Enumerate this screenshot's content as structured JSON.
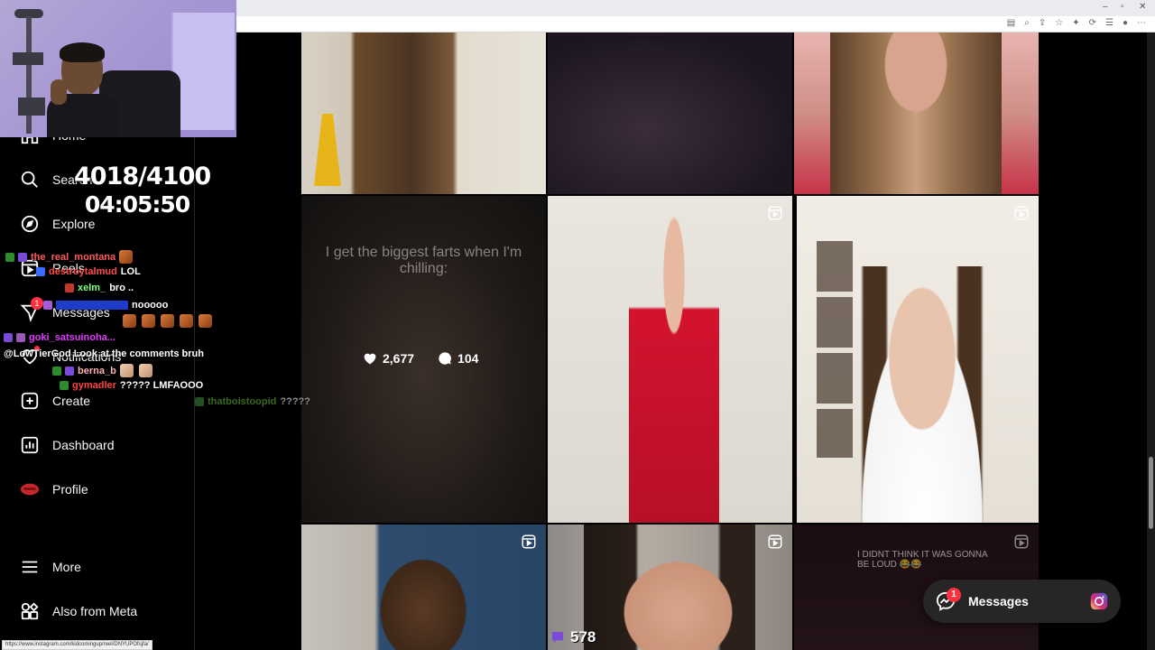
{
  "sidebar": {
    "items": [
      {
        "label": "Home",
        "icon": "home-icon"
      },
      {
        "label": "Search",
        "icon": "search-icon"
      },
      {
        "label": "Explore",
        "icon": "compass-icon"
      },
      {
        "label": "Reels",
        "icon": "reels-icon"
      },
      {
        "label": "Messages",
        "icon": "messenger-icon",
        "badge": "1"
      },
      {
        "label": "Notifications",
        "icon": "heart-icon"
      },
      {
        "label": "Create",
        "icon": "plus-square-icon"
      },
      {
        "label": "Dashboard",
        "icon": "dashboard-icon"
      },
      {
        "label": "Profile",
        "icon": "avatar"
      },
      {
        "label": "More",
        "icon": "menu-icon"
      },
      {
        "label": "Also from Meta",
        "icon": "meta-apps-icon"
      }
    ]
  },
  "overlay": {
    "counter": "4018/4100",
    "timer": "04:05:50",
    "viewers": "578"
  },
  "chat": [
    {
      "user": "the_real_montana",
      "color": "#ff5a5a",
      "msg": ""
    },
    {
      "user": "destroytalmud",
      "color": "#ff4d4d",
      "msg": "LOL"
    },
    {
      "user": "xelm_",
      "color": "#7cff7c",
      "msg": "bro .."
    },
    {
      "user": "",
      "color": "#3a6cff",
      "msg": "nooooo"
    },
    {
      "user": "goki_satsuinoha...",
      "color": "#e03cff",
      "msg": "@LowTierGod Look at the comments bruh"
    },
    {
      "user": "berna_b",
      "color": "#ffb0b0",
      "msg": ""
    },
    {
      "user": "gymadler",
      "color": "#ff4040",
      "msg": "????? LMFAOOO"
    },
    {
      "user": "thatboistoopid",
      "color": "#4e8a2a",
      "msg": "?????"
    }
  ],
  "grid": {
    "tile_caption_1": "I get the biggest farts when I'm chilling:",
    "likes": "2,677",
    "comments": "104",
    "tile_caption_2": "I DIDNT THINK IT WAS GONNA BE LOUD 😂😂"
  },
  "messages_pill": {
    "label": "Messages",
    "badge": "1"
  },
  "status_url": "https://www.instagram.com/kidcomingup/reel/DNYUPOfsjfa/",
  "colors": {
    "accent_red": "#ff3040",
    "sidebar_bg": "#000000",
    "pill_bg": "#262626"
  }
}
